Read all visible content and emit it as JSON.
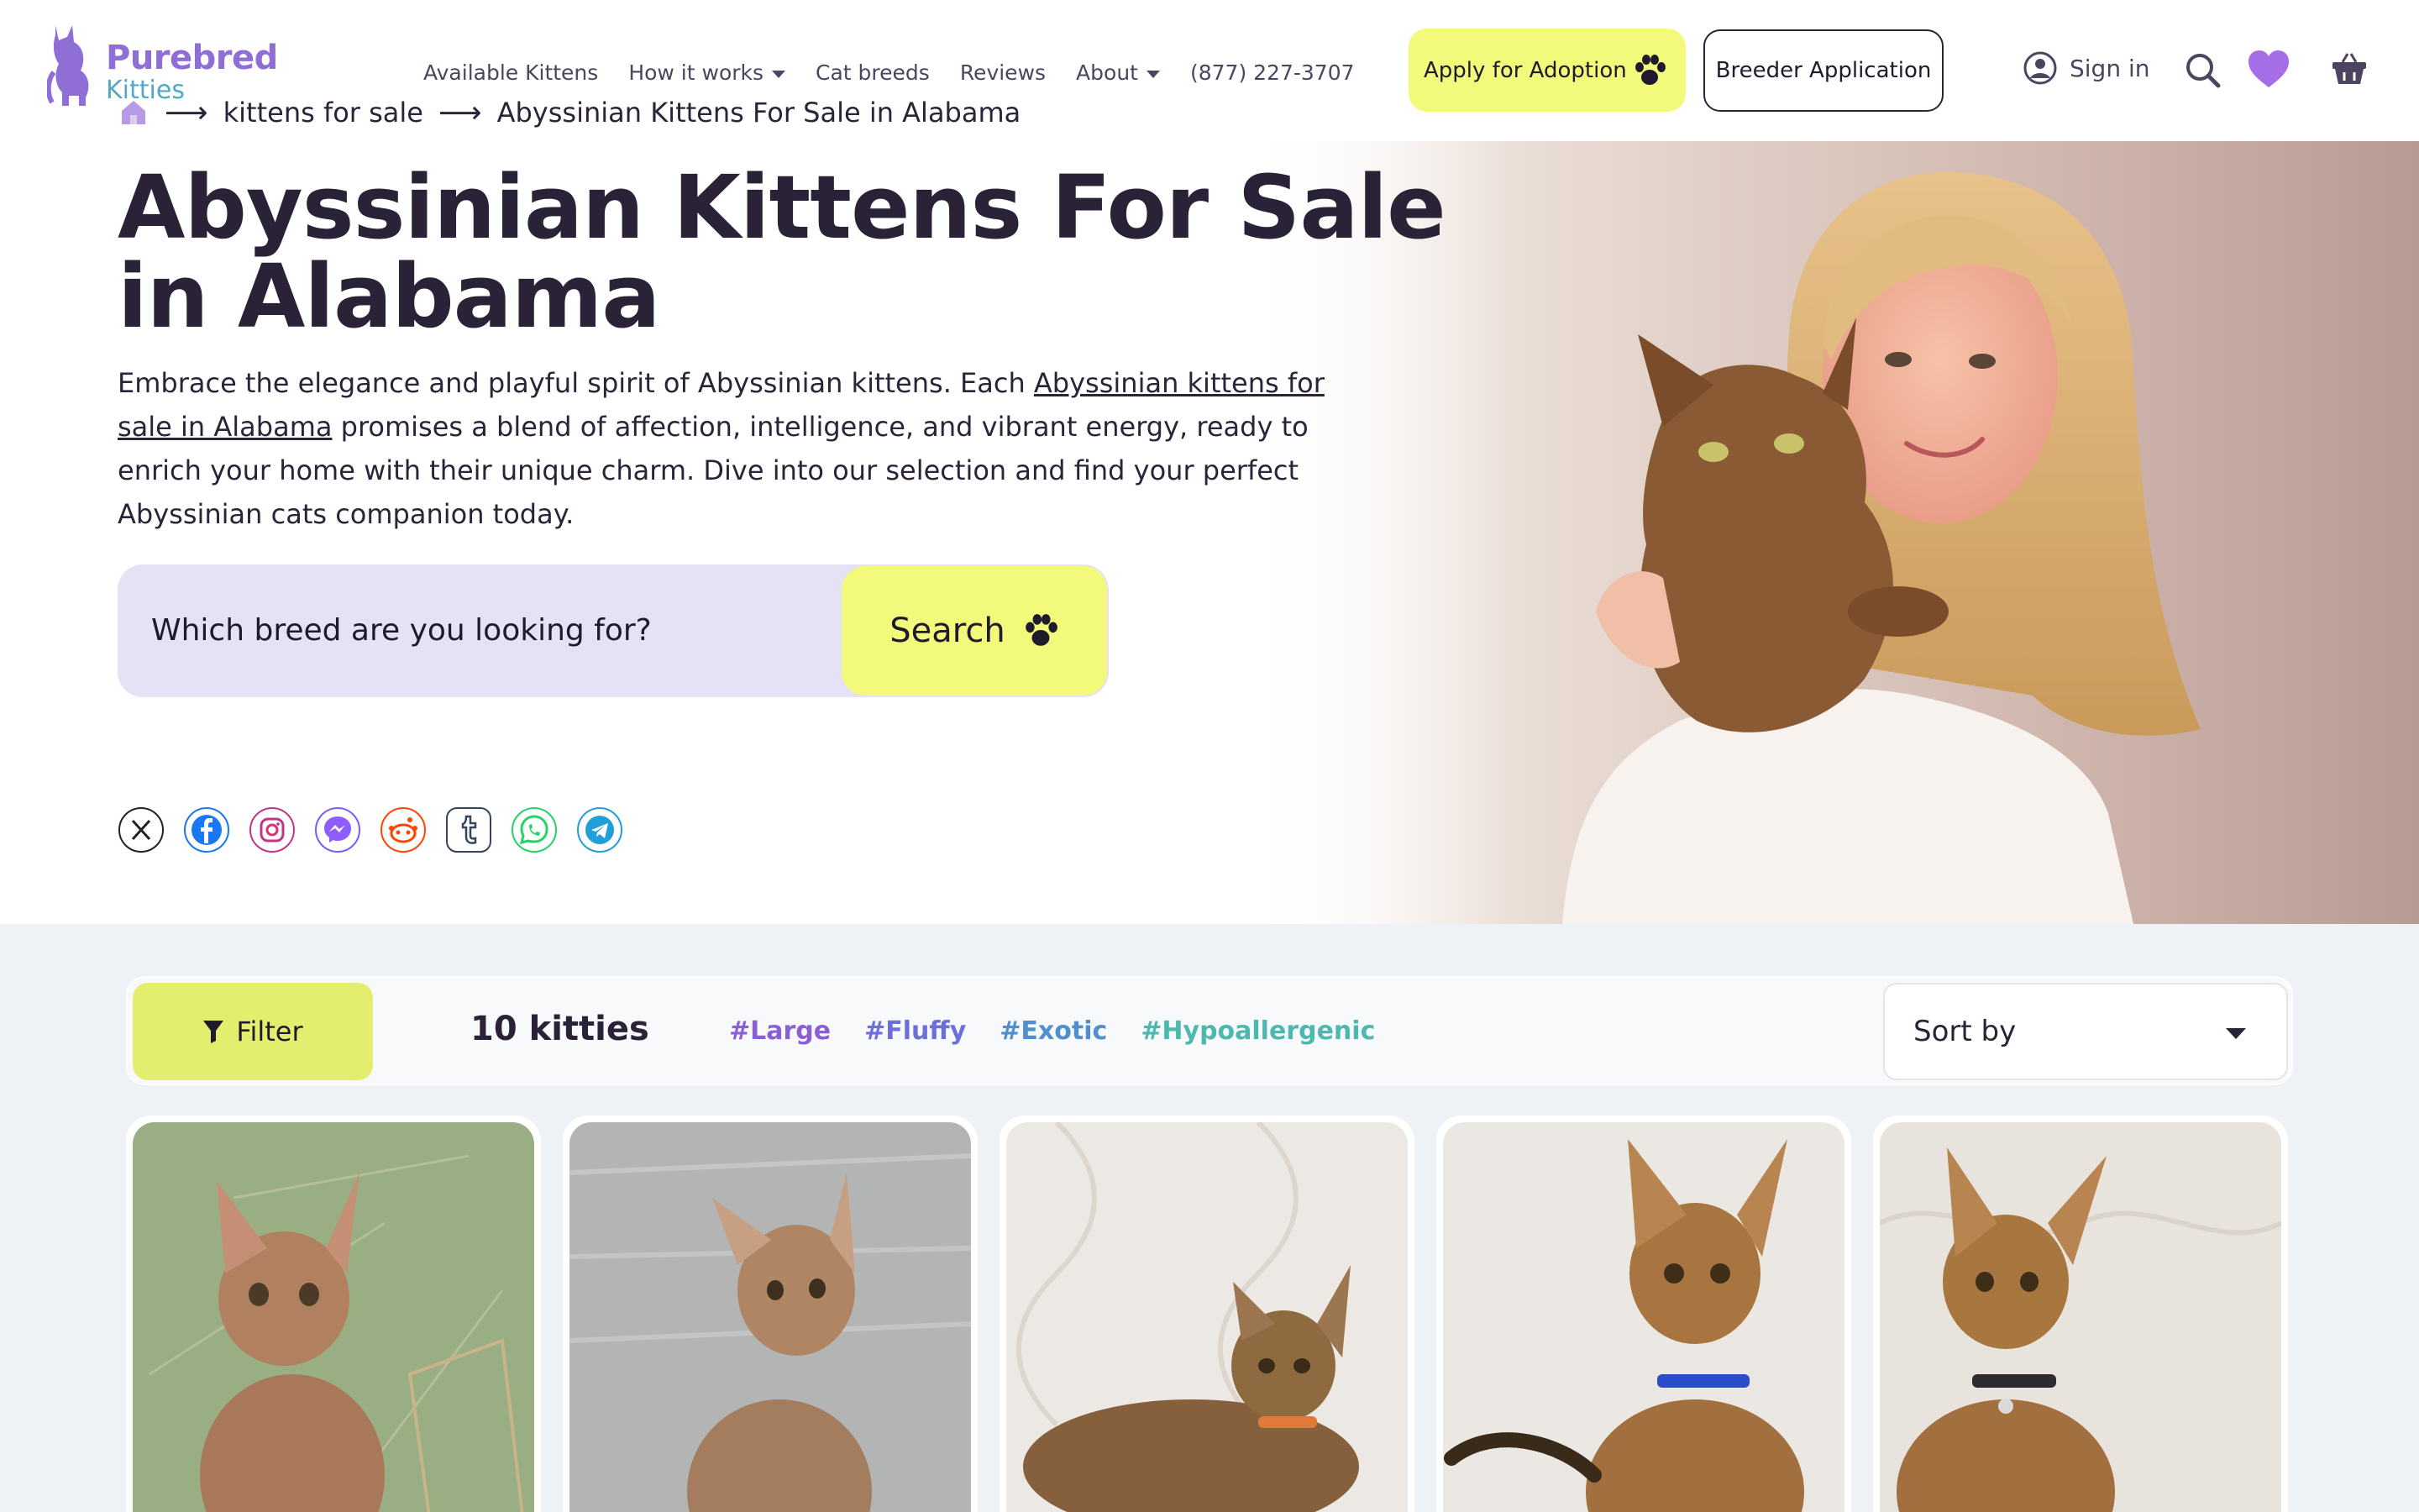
{
  "header": {
    "logo_word1": "Purebred",
    "logo_word2": "Kitties",
    "nav": [
      {
        "label": "Available Kittens",
        "dropdown": false
      },
      {
        "label": "How it works",
        "dropdown": true
      },
      {
        "label": "Cat breeds",
        "dropdown": false
      },
      {
        "label": "Reviews",
        "dropdown": false
      },
      {
        "label": "About",
        "dropdown": true
      },
      {
        "label": "(877) 227-3707",
        "dropdown": false
      }
    ],
    "apply_label": "Apply for Adoption",
    "breeder_label": "Breeder Application",
    "signin_label": "Sign in",
    "colors": {
      "accent_yellow": "#f3f97a",
      "brand_purple": "#8f6fd6",
      "brand_teal": "#54a8c7",
      "heart": "#a66ee6"
    }
  },
  "breadcrumb": {
    "items": [
      "kittens for sale",
      "Abyssinian Kittens For Sale in Alabama"
    ]
  },
  "hero": {
    "title": "Abyssinian Kittens For Sale in Alabama",
    "desc_before": "Embrace the elegance and playful spirit of Abyssinian kittens. Each ",
    "desc_link": "Abyssinian kittens for sale in Alabama",
    "desc_after": " promises a blend of affection, intelligence, and vibrant energy, ready to enrich your home with their unique charm. Dive into our selection and find your perfect Abyssinian cats companion today.",
    "search_placeholder": "Which breed are you looking for?",
    "search_button": "Search",
    "socials": [
      "x-icon",
      "facebook-icon",
      "instagram-icon",
      "messenger-icon",
      "reddit-icon",
      "tumblr-icon",
      "whatsapp-icon",
      "telegram-icon"
    ]
  },
  "listing": {
    "filter_label": "Filter",
    "count_label": "10 kitties",
    "tags": [
      {
        "label": "#Large",
        "color": "#8a5fd6"
      },
      {
        "label": "#Fluffy",
        "color": "#6b6fd9"
      },
      {
        "label": "#Exotic",
        "color": "#4f8fd0"
      },
      {
        "label": "#Hypoallergenic",
        "color": "#4db8b0"
      }
    ],
    "sort_label": "Sort by",
    "cards": [
      {
        "bg": "#8fa27a"
      },
      {
        "bg": "#a7a9a8"
      },
      {
        "bg": "#e8e4de"
      },
      {
        "bg": "#e9e6e1"
      },
      {
        "bg": "#e6e2db"
      }
    ]
  }
}
